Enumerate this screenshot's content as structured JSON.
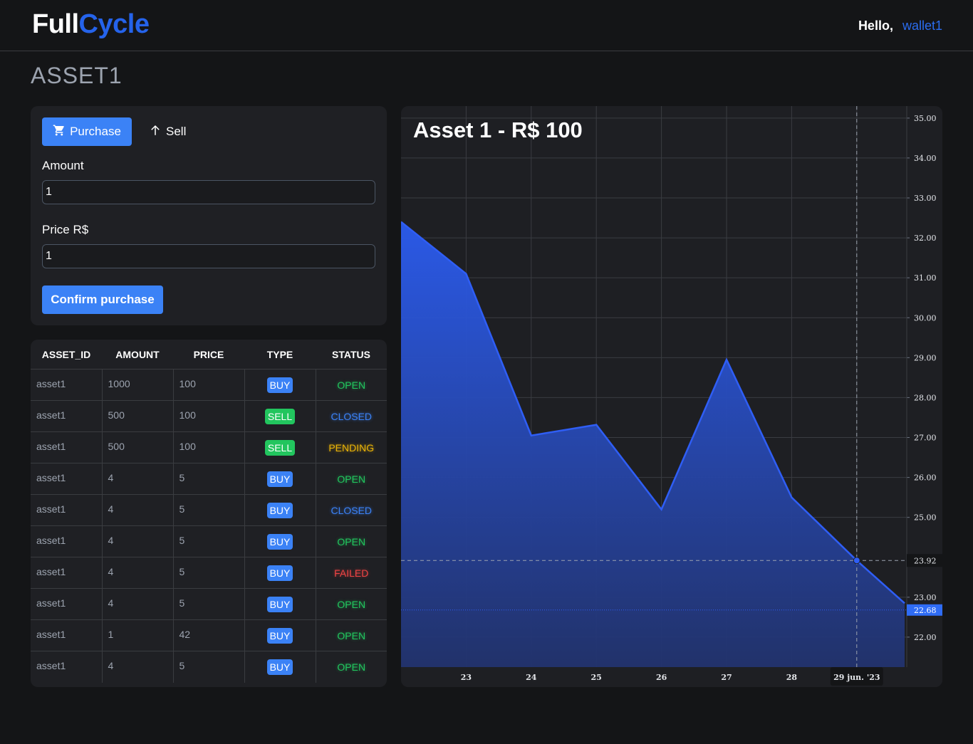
{
  "header": {
    "logo_full": "Full",
    "logo_cycle": "Cycle",
    "hello": "Hello,",
    "wallet": "wallet1"
  },
  "page": {
    "title": "ASSET1"
  },
  "order_form": {
    "purchase_tab": "Purchase",
    "sell_tab": "Sell",
    "amount_label": "Amount",
    "amount_value": "1",
    "price_label": "Price R$",
    "price_value": "1",
    "confirm_label": "Confirm purchase"
  },
  "orders_table": {
    "headers": [
      "ASSET_ID",
      "AMOUNT",
      "PRICE",
      "TYPE",
      "STATUS"
    ],
    "rows": [
      {
        "asset_id": "asset1",
        "amount": "1000",
        "price": "100",
        "type": "BUY",
        "status": "OPEN"
      },
      {
        "asset_id": "asset1",
        "amount": "500",
        "price": "100",
        "type": "SELL",
        "status": "CLOSED"
      },
      {
        "asset_id": "asset1",
        "amount": "500",
        "price": "100",
        "type": "SELL",
        "status": "PENDING"
      },
      {
        "asset_id": "asset1",
        "amount": "4",
        "price": "5",
        "type": "BUY",
        "status": "OPEN"
      },
      {
        "asset_id": "asset1",
        "amount": "4",
        "price": "5",
        "type": "BUY",
        "status": "CLOSED"
      },
      {
        "asset_id": "asset1",
        "amount": "4",
        "price": "5",
        "type": "BUY",
        "status": "OPEN"
      },
      {
        "asset_id": "asset1",
        "amount": "4",
        "price": "5",
        "type": "BUY",
        "status": "FAILED"
      },
      {
        "asset_id": "asset1",
        "amount": "4",
        "price": "5",
        "type": "BUY",
        "status": "OPEN"
      },
      {
        "asset_id": "asset1",
        "amount": "1",
        "price": "42",
        "type": "BUY",
        "status": "OPEN"
      },
      {
        "asset_id": "asset1",
        "amount": "4",
        "price": "5",
        "type": "BUY",
        "status": "OPEN"
      }
    ]
  },
  "colors": {
    "accent": "#3b82f6",
    "brand": "#2563eb",
    "open": "#22c55e",
    "pending": "#eab308",
    "failed": "#ef4444",
    "series_line": "#2f5ef5"
  },
  "icons": {
    "purchase": "cart-icon",
    "sell": "arrow-up-icon"
  },
  "chart_data": {
    "type": "area",
    "title": "Asset 1 - R$ 100",
    "x": [
      "22",
      "23",
      "24",
      "25",
      "26",
      "27",
      "28",
      "29 jun. '23",
      "30"
    ],
    "x_tick_labels": [
      "23",
      "24",
      "25",
      "26",
      "27",
      "28",
      "29 jun. '23"
    ],
    "values": [
      32.4,
      31.1,
      27.05,
      27.32,
      25.2,
      28.95,
      25.5,
      23.92,
      22.85
    ],
    "y_tick_labels": [
      "35.00",
      "34.00",
      "33.00",
      "32.00",
      "31.00",
      "30.00",
      "29.00",
      "28.00",
      "27.00",
      "26.00",
      "25.00",
      "23.00",
      "22.00"
    ],
    "ylim": [
      21.25,
      35.3
    ],
    "crosshair": {
      "x": "29 jun. '23",
      "value_label": "23.92"
    },
    "last_value_label": "22.68",
    "grid": true
  }
}
